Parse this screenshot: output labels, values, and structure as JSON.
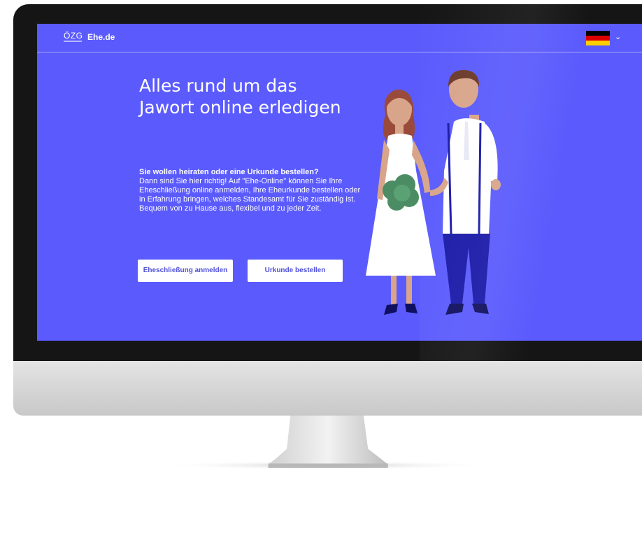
{
  "header": {
    "logo_text": "ÖZG",
    "brand_name": "Ehe.de",
    "language_flag_colors": [
      "#000000",
      "#dd0000",
      "#ffce00"
    ],
    "language_icon": "chevron-down-icon"
  },
  "hero": {
    "headline": "Alles rund um das Jawort online erledigen",
    "intro_bold": "Sie wollen heiraten oder eine Urkunde bestellen?",
    "intro_text": "Dann sind Sie hier richtig! Auf \"Ehe-Online\" können Sie Ihre Eheschließung online anmelden, Ihre Eheurkunde bestellen oder in Erfahrung bringen, welches Standesamt für Sie zuständig ist. Bequem von zu Hause aus, flexibel und zu jeder Zeit.",
    "primary_button": "Eheschließung anmelden",
    "secondary_button": "Urkunde bestellen"
  },
  "colors": {
    "page_background": "#5b5bfd",
    "button_text": "#4f4fd9"
  }
}
